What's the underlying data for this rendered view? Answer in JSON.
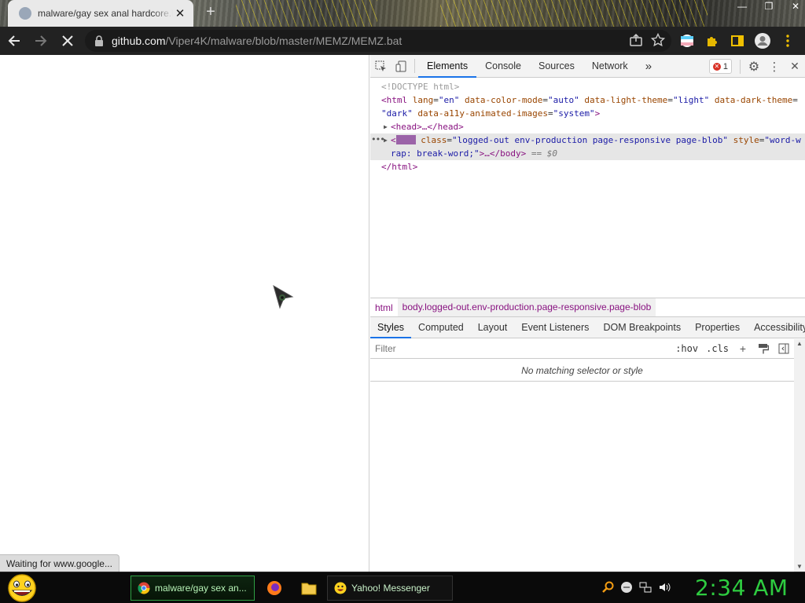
{
  "browser": {
    "tab": {
      "title": "malware/gay sex anal hardcore.bat"
    },
    "address": {
      "host": "github.com",
      "path": "/Viper4K/malware/blob/master/MEMZ/MEMZ.bat"
    },
    "status_text": "Waiting for www.google..."
  },
  "devtools": {
    "tabs": [
      "Elements",
      "Console",
      "Sources",
      "Network"
    ],
    "more_tabs": "»",
    "error_count": "1",
    "dom": {
      "doctype": "<!DOCTYPE html>",
      "html_open": {
        "tag": "<html",
        "attrs": [
          {
            "name": "lang",
            "value": "\"en\""
          },
          {
            "name": "data-color-mode",
            "value": "\"auto\""
          },
          {
            "name": "data-light-theme",
            "value": "\"light\""
          },
          {
            "name": "data-dark-theme",
            "value": "="
          }
        ],
        "wrap": "\"dark\"",
        "wrap_attr": "data-a11y-animated-images",
        "wrap_val": "\"system\"",
        "close": ">"
      },
      "head": "<head>…</head>",
      "body": {
        "class_attr": "class",
        "class_val": "\"logged-out env-production page-responsive page-blob\"",
        "style_attr": "style",
        "style_val_1": "\"word-w",
        "style_val_2": "rap: break-word;\"",
        "tail": ">…</body>",
        "eq": "== $0"
      },
      "html_close": "</html>"
    },
    "breadcrumbs": [
      "html",
      "body.logged-out.env-production.page-responsive.page-blob"
    ],
    "style_tabs": [
      "Styles",
      "Computed",
      "Layout",
      "Event Listeners",
      "DOM Breakpoints",
      "Properties",
      "Accessibility"
    ],
    "filter_placeholder": "Filter",
    "hov": ":hov",
    "cls": ".cls",
    "no_match": "No matching selector or style"
  },
  "taskbar": {
    "chrome_task": "malware/gay sex an...",
    "yahoo_task": "Yahoo! Messenger",
    "clock": "2:34 AM"
  },
  "colors": {
    "toolbar": "#222222",
    "accent": "#1a73e8",
    "clock": "#2ecc40",
    "task_active_border": "#2ea043"
  }
}
